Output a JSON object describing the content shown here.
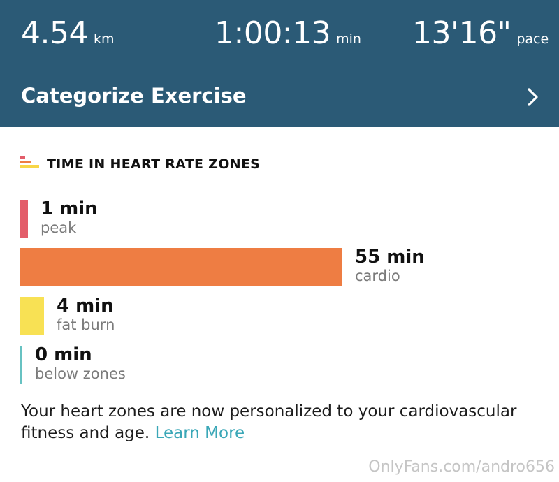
{
  "summary": {
    "distance": {
      "value": "4.54",
      "unit": "km"
    },
    "duration": {
      "value": "1:00:13",
      "unit": "min"
    },
    "pace": {
      "value": "13'16\"",
      "unit": "pace"
    }
  },
  "categorize": {
    "label": "Categorize Exercise",
    "icon": "chevron-right-icon"
  },
  "zones_section": {
    "title": "TIME IN HEART RATE ZONES",
    "icon": "heart-rate-zones-icon",
    "total_minutes": 60,
    "zones": [
      {
        "minutes_label": "1 min",
        "name": "peak",
        "minutes": 1,
        "color": "#e35d6a"
      },
      {
        "minutes_label": "55 min",
        "name": "cardio",
        "minutes": 55,
        "color": "#ee7d43"
      },
      {
        "minutes_label": "4 min",
        "name": "fat burn",
        "minutes": 4,
        "color": "#f8e154"
      },
      {
        "minutes_label": "0 min",
        "name": "below zones",
        "minutes": 0,
        "color": "#67c2c2"
      }
    ]
  },
  "footer": {
    "text": "Your heart zones are now personalized to your cardiovascular fitness and age.",
    "link_label": "Learn More"
  },
  "watermark": "OnlyFans.com/andro656"
}
